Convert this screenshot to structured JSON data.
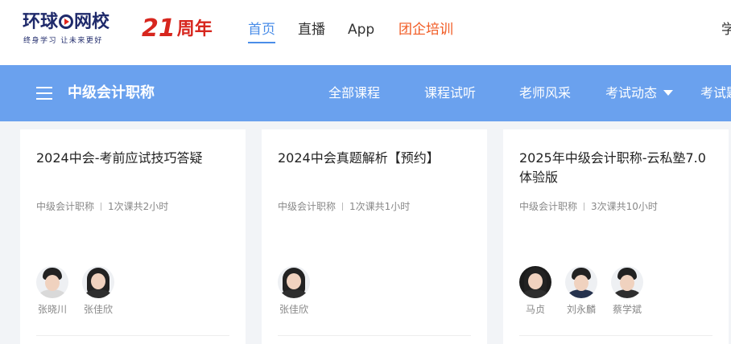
{
  "header": {
    "logo_text_a": "环球",
    "logo_text_b": "网校",
    "logo_slogan": "终身学习 让未来更好",
    "anniversary_number": "21",
    "anniversary_text": "周年",
    "nav": [
      "首页",
      "直播",
      "App",
      "团企培训"
    ],
    "cut_off_text": "学"
  },
  "category_bar": {
    "title": "中级会计职称",
    "links": [
      "全部课程",
      "课程试听",
      "老师风采",
      "考试动态",
      "考试题"
    ]
  },
  "cards": [
    {
      "title": "2024中会-考前应试技巧答疑",
      "category": "中级会计职称",
      "info": "1次课共2小时",
      "teachers": [
        "张晓川",
        "张佳欣"
      ]
    },
    {
      "title": "2024中会真题解析【预约】",
      "category": "中级会计职称",
      "info": "1次课共1小时",
      "teachers": [
        "张佳欣"
      ]
    },
    {
      "title": "2025年中级会计职称-云私塾7.0体验版",
      "category": "中级会计职称",
      "info": "3次课共10小时",
      "teachers": [
        "马贞",
        "刘永麟",
        "蔡学斌"
      ]
    }
  ],
  "colors": {
    "accent_blue": "#4a8de8",
    "category_bar": "#6aa1ee",
    "orange_link": "#f15a22",
    "anniversary_red": "#d7261e",
    "logo_navy": "#1f2a6b"
  }
}
